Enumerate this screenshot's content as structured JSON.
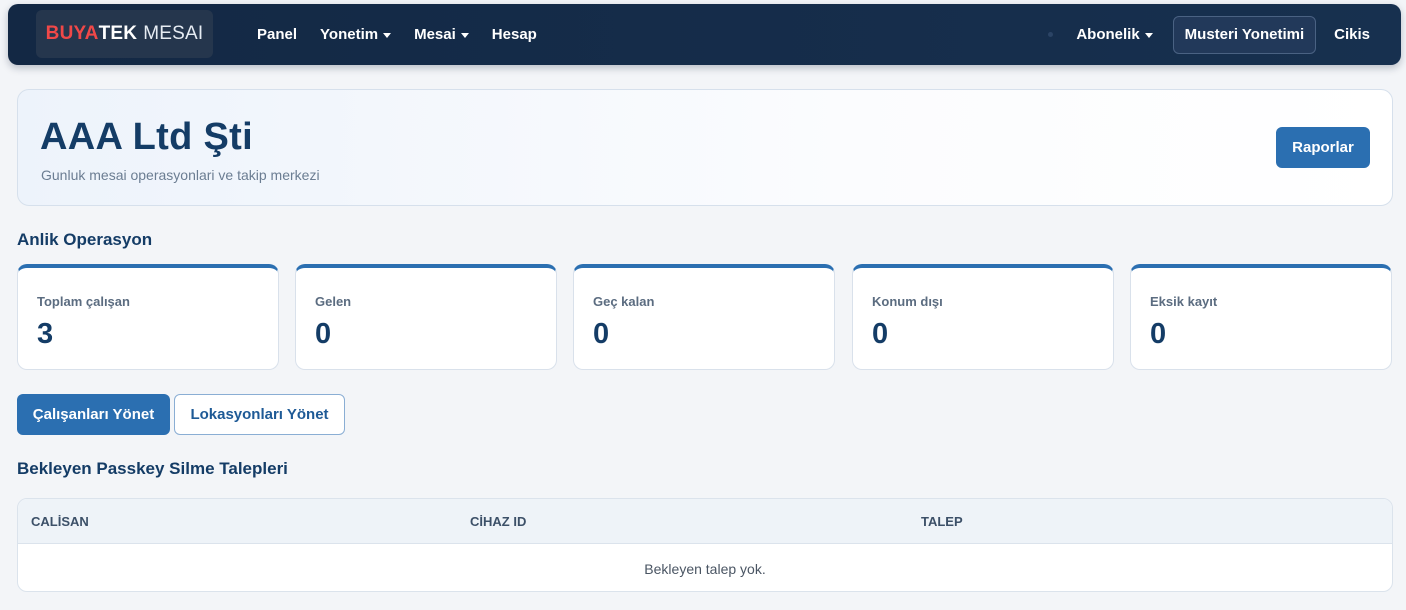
{
  "navbar": {
    "brand": {
      "part1": "BUYA",
      "part2": "TEK",
      "part3": "MESAI"
    },
    "links": [
      {
        "label": "Panel",
        "has_caret": false
      },
      {
        "label": "Yonetim",
        "has_caret": true
      },
      {
        "label": "Mesai",
        "has_caret": true
      },
      {
        "label": "Hesap",
        "has_caret": false
      }
    ],
    "subscription_label": "Abonelik",
    "customer_mgmt_label": "Musteri Yonetimi",
    "logout_label": "Cikis"
  },
  "header": {
    "company": "AAA Ltd Şti",
    "subtitle": "Gunluk mesai operasyonlari ve takip merkezi",
    "reports_button": "Raporlar"
  },
  "live_ops": {
    "title": "Anlik Operasyon",
    "stats": [
      {
        "label": "Toplam çalışan",
        "value": "3"
      },
      {
        "label": "Gelen",
        "value": "0"
      },
      {
        "label": "Geç kalan",
        "value": "0"
      },
      {
        "label": "Konum dışı",
        "value": "0"
      },
      {
        "label": "Eksik kayıt",
        "value": "0"
      }
    ]
  },
  "actions": {
    "manage_employees": "Çalışanları Yönet",
    "manage_locations": "Lokasyonları Yönet"
  },
  "passkey": {
    "title": "Bekleyen Passkey Silme Talepleri",
    "columns": [
      "CALİSAN",
      "CİHAZ ID",
      "TALEP"
    ],
    "empty_message": "Bekleyen talep yok."
  },
  "colors": {
    "navbar_bg": "#132844",
    "primary": "#2b6fb1",
    "brand_accent": "#f04848",
    "heading": "#143c66"
  }
}
